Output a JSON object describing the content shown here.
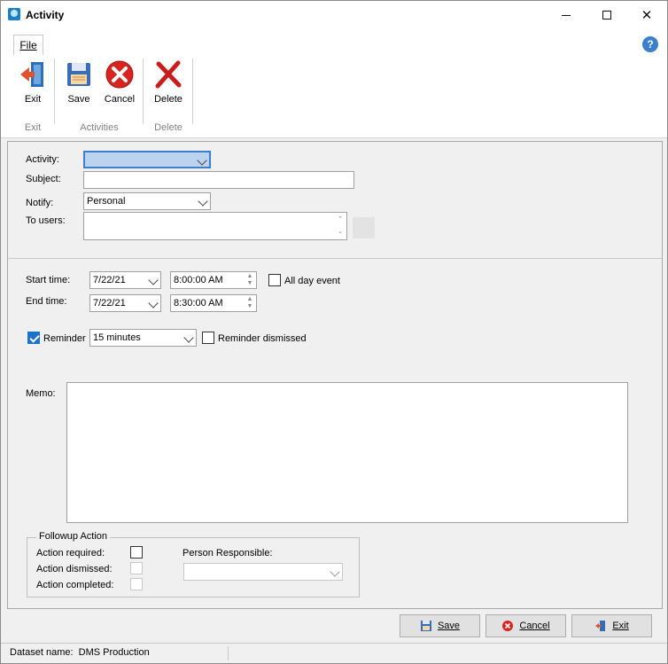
{
  "window": {
    "title": "Activity"
  },
  "ribbon": {
    "tab_file": "File",
    "buttons": {
      "exit": "Exit",
      "save": "Save",
      "cancel": "Cancel",
      "delete": "Delete"
    },
    "groups": {
      "exit": "Exit",
      "activities": "Activities",
      "delete": "Delete"
    }
  },
  "form": {
    "activity_label": "Activity:",
    "activity_value": "",
    "subject_label": "Subject:",
    "subject_value": "",
    "notify_label": "Notify:",
    "notify_value": "Personal",
    "to_users_label": "To users:",
    "to_users_value": "",
    "start_label": "Start time:",
    "start_date": "7/22/21",
    "start_time": "8:00:00 AM",
    "end_label": "End time:",
    "end_date": "7/22/21",
    "end_time": "8:30:00 AM",
    "all_day_label": "All day event",
    "all_day_checked": false,
    "reminder_label": "Reminder",
    "reminder_checked": true,
    "reminder_value": "15 minutes",
    "reminder_dismissed_label": "Reminder dismissed",
    "reminder_dismissed_checked": false,
    "memo_label": "Memo:",
    "memo_value": ""
  },
  "followup": {
    "title": "Followup Action",
    "action_required_label": "Action required:",
    "action_dismissed_label": "Action dismissed:",
    "action_completed_label": "Action completed:",
    "person_label": "Person Responsible:",
    "person_value": ""
  },
  "footer": {
    "save": "Save",
    "cancel": "Cancel",
    "exit": "Exit"
  },
  "status": {
    "text": "Dataset name:  DMS Production"
  },
  "colors": {
    "accent": "#1a73c9",
    "cancel_red": "#d9231f",
    "selected_field": "#bcd3f0"
  }
}
